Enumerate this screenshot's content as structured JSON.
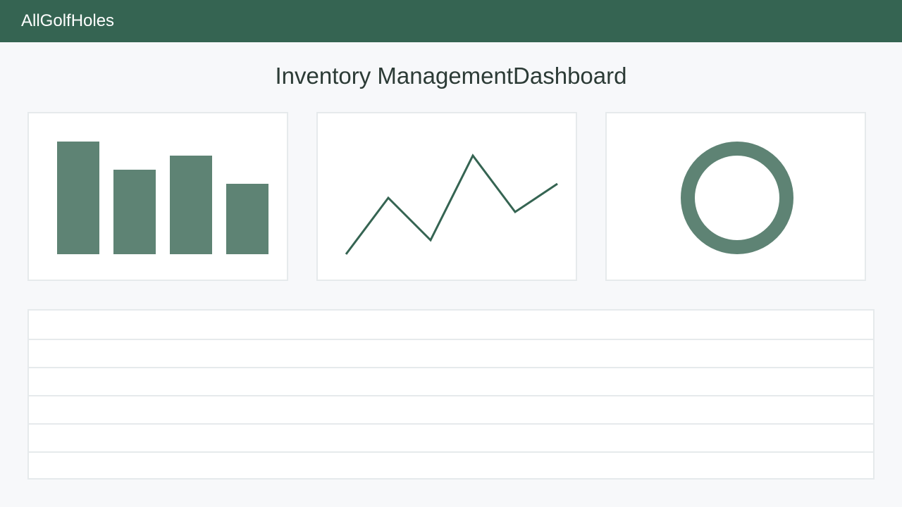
{
  "header": {
    "brand": "AllGolfHoles"
  },
  "main": {
    "title": "Inventory ManagementDashboard"
  },
  "colors": {
    "header_bg": "#356452",
    "bar_fill": "#5e8374",
    "line_stroke": "#356452",
    "donut_stroke": "#5e8374",
    "border": "#e6eaec",
    "page_bg": "#f7f8fa"
  },
  "bar_chart": {
    "values": [
      160,
      120,
      140,
      100
    ]
  },
  "line_chart": {
    "values": [
      0,
      80,
      20,
      140,
      60,
      100
    ]
  },
  "donut_chart": {
    "fraction": 1.0
  },
  "table": {
    "row_count": 6
  }
}
